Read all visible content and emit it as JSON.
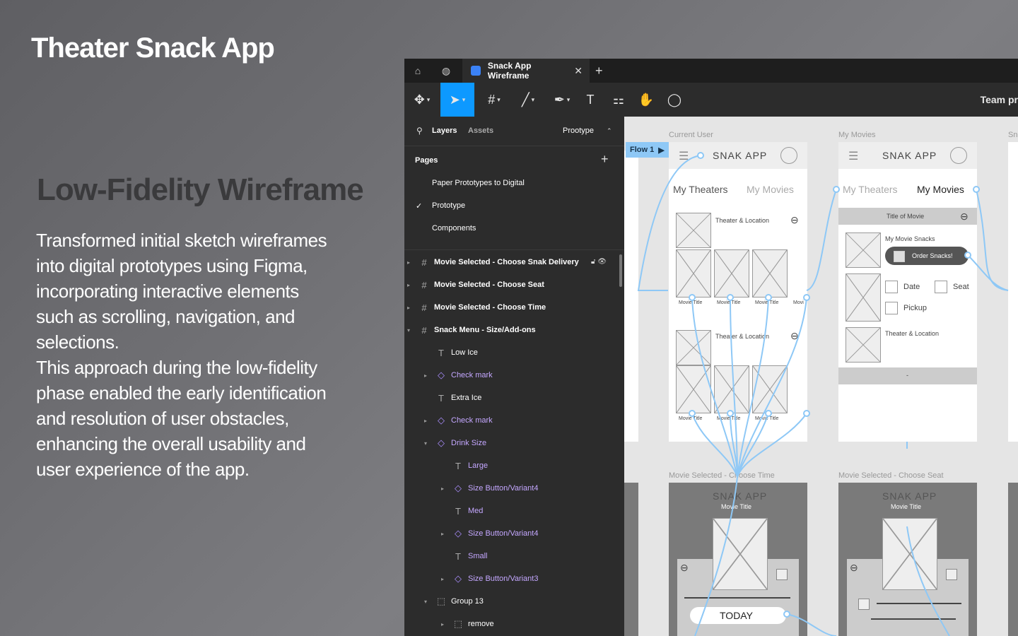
{
  "slide": {
    "title": "Theater Snack App",
    "heading": "Low-Fidelity Wireframe",
    "paragraph_1": "Transformed initial sketch wireframes into digital prototypes using Figma, incorporating interactive elements such as scrolling, navigation, and selections.",
    "paragraph_2": "This approach during the low-fidelity phase enabled the early identification and resolution of user obstacles, enhancing the overall usability and user experience of the app."
  },
  "figma": {
    "tab": {
      "name": "Snack App Wireframe"
    },
    "toolbar": {
      "team": "Team pr"
    },
    "panel": {
      "tabs": [
        "Layers",
        "Assets"
      ],
      "mode": "Prootype",
      "pages_title": "Pages",
      "pages": [
        "Paper Prototypes to Digital",
        "Prototype",
        "Components"
      ],
      "layers": [
        "Movie Selected - Choose Snak Delivery",
        "Movie Selected - Choose Seat",
        "Movie Selected - Choose Time",
        "Snack Menu - Size/Add-ons",
        "Low Ice",
        "Check mark",
        "Extra Ice",
        "Check mark",
        "Drink Size",
        "Large",
        "Size Button/Variant4",
        "Med",
        "Size Button/Variant4",
        "Small",
        "Size Button/Variant3",
        "Group 13",
        "remove"
      ]
    },
    "canvas": {
      "flow": "Flow 1",
      "frames": {
        "current_user": "Current User",
        "my_movies": "My Movies",
        "third": "Sn",
        "choose_time": "Movie Selected - Choose Time",
        "choose_seat": "Movie Selected - Choose Seat"
      },
      "app_name": "SNAK APP",
      "tab_theaters": "My Theaters",
      "tab_movies": "My Movies",
      "theater_location": "Theater & Location",
      "movie_title": "Movie Title",
      "movie_short": "Movi",
      "movie_title_bar": "Title of Movie",
      "my_movie_snacks": "My Movie Snacks",
      "order_snacks": "Order Snacks!",
      "date": "Date",
      "seat": "Seat",
      "pickup": "Pickup",
      "dash": "-",
      "today": "TODAY"
    }
  }
}
